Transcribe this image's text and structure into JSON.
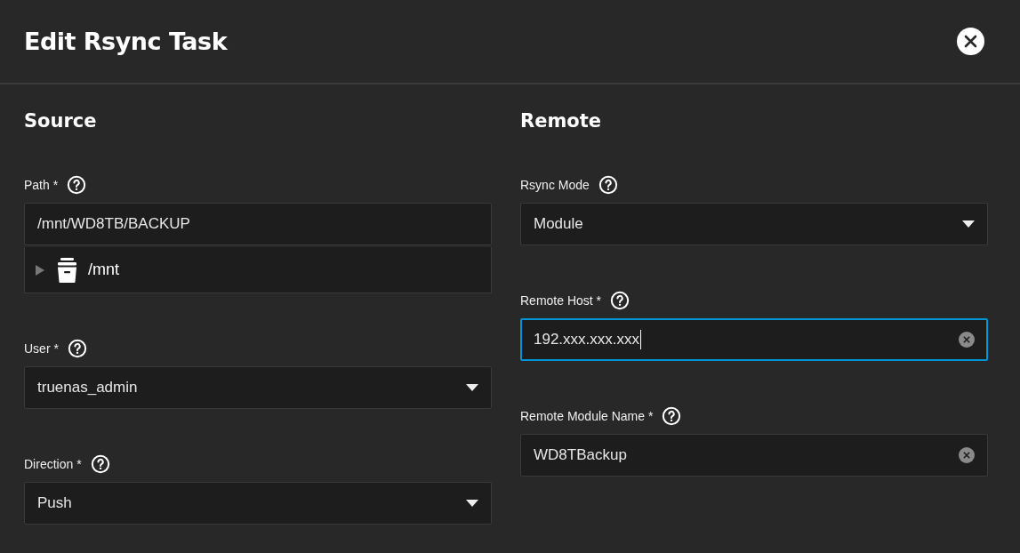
{
  "dialog": {
    "title": "Edit Rsync Task"
  },
  "sections": [
    {
      "title": "Source",
      "fields": [
        {
          "kind": "path",
          "label": "Path *",
          "value": "/mnt/WD8TB/BACKUP",
          "tree": {
            "label": "/mnt",
            "expanded": false
          }
        },
        {
          "kind": "select",
          "label": "User *",
          "value": "truenas_admin"
        },
        {
          "kind": "select",
          "label": "Direction *",
          "value": "Push"
        }
      ]
    },
    {
      "title": "Remote",
      "fields": [
        {
          "kind": "select",
          "label": "Rsync Mode",
          "value": "Module"
        },
        {
          "kind": "text",
          "label": "Remote Host *",
          "value": "192.xxx.xxx.xxx",
          "focused": true
        },
        {
          "kind": "text",
          "label": "Remote Module Name *",
          "value": "WD8TBackup",
          "focused": false
        }
      ]
    }
  ]
}
